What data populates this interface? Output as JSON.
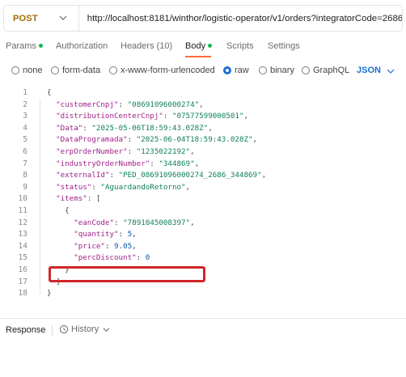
{
  "request": {
    "method": "POST",
    "url": "http://localhost:8181/winthor/logistic-operator/v1/orders?integratorCode=2686"
  },
  "tabs": [
    {
      "label": "Params",
      "dot": true
    },
    {
      "label": "Authorization",
      "dot": false
    },
    {
      "label": "Headers",
      "count": "(10)"
    },
    {
      "label": "Body",
      "dot": true,
      "active": true
    },
    {
      "label": "Scripts",
      "dot": false
    },
    {
      "label": "Settings",
      "dot": false
    }
  ],
  "body_options": {
    "items": [
      "none",
      "form-data",
      "x-www-form-urlencoded",
      "raw",
      "binary",
      "GraphQL"
    ],
    "selected": "raw",
    "format": "JSON"
  },
  "editor": {
    "line_numbers": [
      "1",
      "2",
      "3",
      "4",
      "5",
      "6",
      "7",
      "8",
      "9",
      "10",
      "11",
      "12",
      "13",
      "14",
      "15",
      "16",
      "17",
      "18"
    ],
    "lines": [
      "{",
      "  \"customerCnpj\": \"08691096000274\",",
      "  \"distributionCenterCnpj\": \"07577599000501\",",
      "  \"Data\": \"2025-05-06T18:59:43.028Z\",",
      "  \"DataProgramada\": \"2025-06-04T18:59:43.028Z\",",
      "  \"erpOrderNumber\": \"1235022192\",",
      "  \"industryOrderNumber\": \"344869\",",
      "  \"externalId\": \"PED_08691096000274_2686_344869\",",
      "  \"status\": \"AguardandoRetorno\",",
      "  \"items\": [",
      "    {",
      "      \"eanCode\": \"7891045008397\",",
      "      \"quantity\": 5,",
      "      \"price\": 9.05,",
      "      \"percDiscount\": 0",
      "    }",
      "  ]",
      "}"
    ]
  },
  "response": {
    "title": "Response",
    "history_label": "History"
  },
  "colors": {
    "method": "#a36c00",
    "accent": "#ff6c37",
    "highlight": "#d1262a",
    "json_key": "#a3218a",
    "json_string": "#0e7f5e",
    "json_number": "#0d55a8"
  }
}
